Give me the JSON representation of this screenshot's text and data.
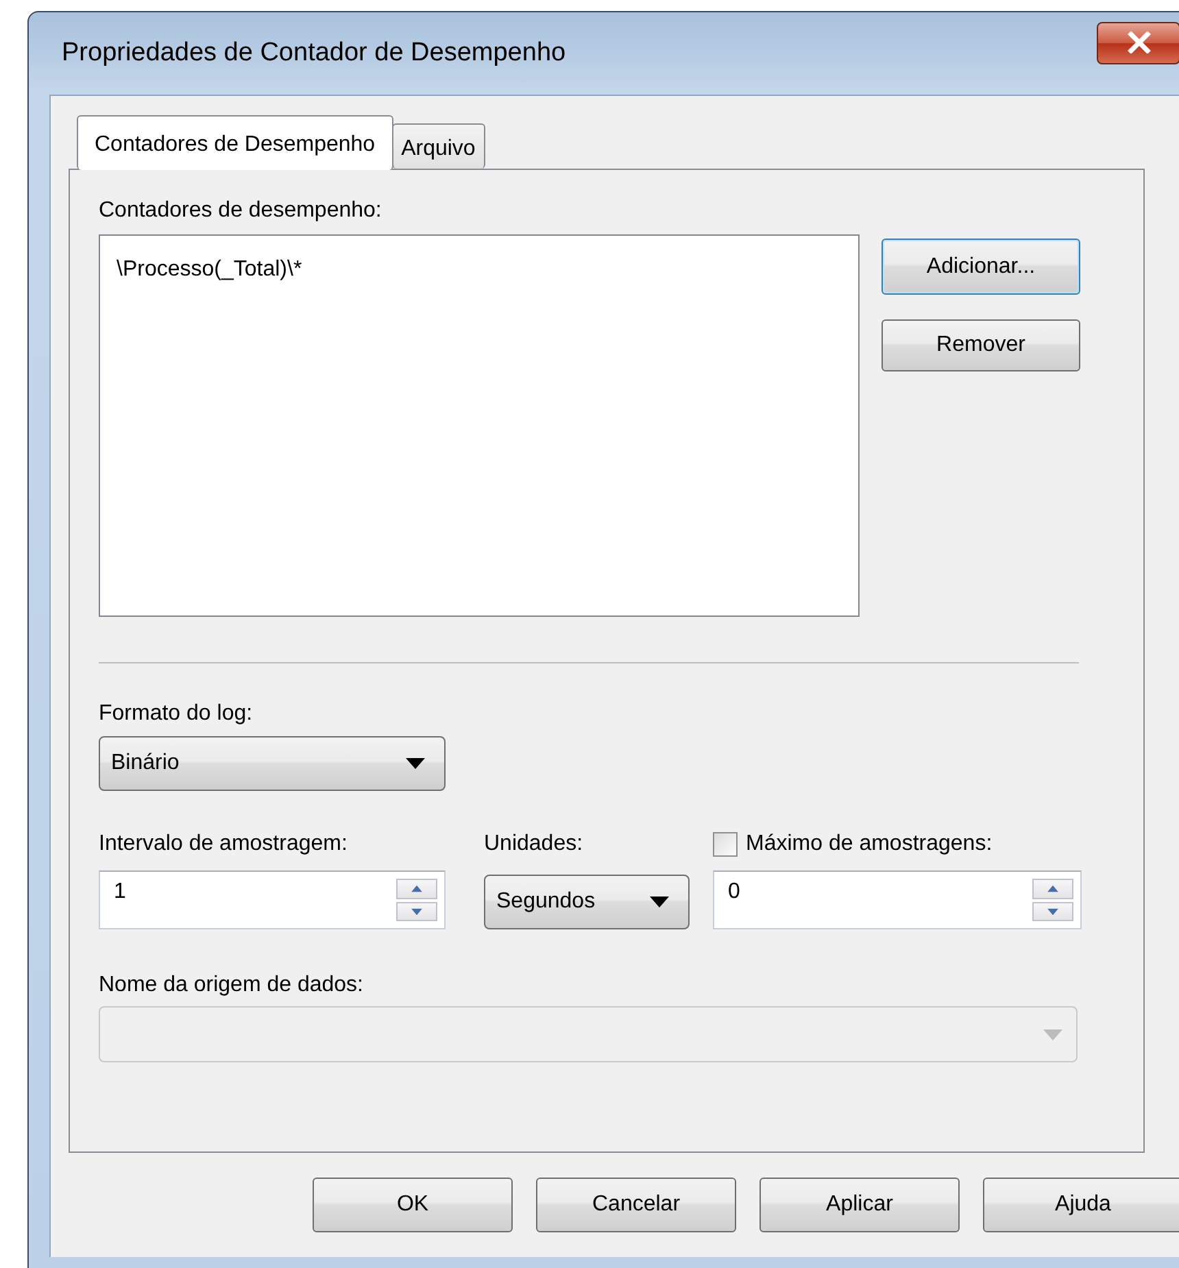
{
  "window": {
    "title": "Propriedades de Contador de Desempenho"
  },
  "tabs": [
    {
      "label": "Contadores de Desempenho",
      "selected": true
    },
    {
      "label": "Arquivo",
      "selected": false
    }
  ],
  "counters": {
    "label": "Contadores de desempenho:",
    "items": [
      "\\Processo(_Total)\\*"
    ],
    "buttons": [
      {
        "label": "Adicionar...",
        "focused": true
      },
      {
        "label": "Remover",
        "focused": false
      }
    ]
  },
  "log_format": {
    "label": "Formato do log:",
    "value": "Binário"
  },
  "sample_interval": {
    "label": "Intervalo de amostragem:",
    "value": "1"
  },
  "units": {
    "label": "Unidades:",
    "value": "Segundos"
  },
  "max_samples": {
    "label": "Máximo de amostragens:",
    "checked": false,
    "value": "0"
  },
  "data_source": {
    "label": "Nome da origem de dados:",
    "disabled": true
  },
  "footer_buttons": [
    "OK",
    "Cancelar",
    "Aplicar",
    "Ajuda"
  ]
}
